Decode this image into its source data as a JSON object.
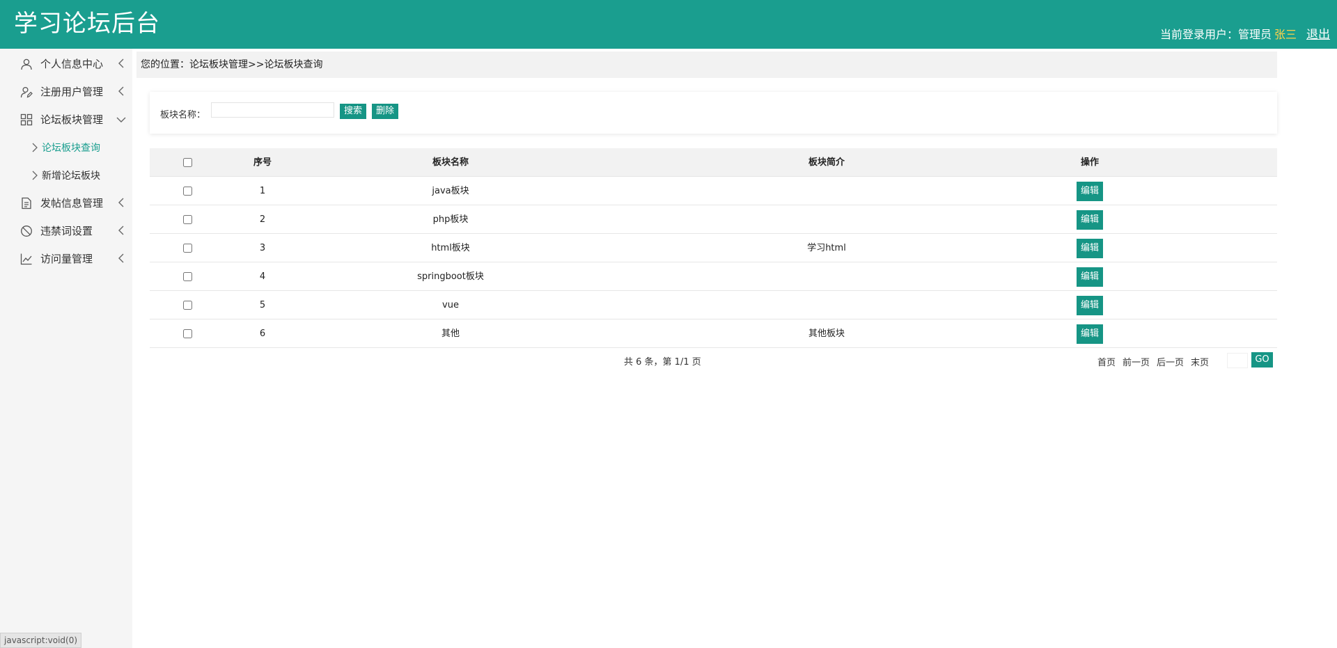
{
  "header": {
    "title": "学习论坛后台",
    "user_prefix": "当前登录用户：管理员",
    "user_name": "张三",
    "logout_label": "退出",
    "colors": {
      "primary": "#1a9e8f",
      "user_name": "#ffd24a"
    }
  },
  "sidebar": {
    "items": [
      {
        "label": "个人信息中心",
        "icon": "user-icon",
        "expanded": false
      },
      {
        "label": "注册用户管理",
        "icon": "user-edit-icon",
        "expanded": false
      },
      {
        "label": "论坛板块管理",
        "icon": "grid-icon",
        "expanded": true
      },
      {
        "label": "发帖信息管理",
        "icon": "document-icon",
        "expanded": false
      },
      {
        "label": "违禁词设置",
        "icon": "ban-icon",
        "expanded": false
      },
      {
        "label": "访问量管理",
        "icon": "line-chart-icon",
        "expanded": false
      }
    ],
    "subitems": [
      {
        "label": "论坛板块查询",
        "active": true
      },
      {
        "label": "新增论坛板块",
        "active": false
      }
    ]
  },
  "breadcrumb": {
    "prefix": "您的位置：",
    "section": "论坛板块管理",
    "separator": ">>",
    "page": "论坛板块查询"
  },
  "search": {
    "label": "板块名称：",
    "value": "",
    "search_button": "搜索",
    "delete_button": "删除"
  },
  "table": {
    "headers": {
      "no": "序号",
      "name": "板块名称",
      "desc": "板块简介",
      "op": "操作"
    },
    "rows": [
      {
        "no": "1",
        "name": "java板块",
        "desc": "",
        "op": "编辑"
      },
      {
        "no": "2",
        "name": "php板块",
        "desc": "",
        "op": "编辑"
      },
      {
        "no": "3",
        "name": "html板块",
        "desc": "学习html",
        "op": "编辑"
      },
      {
        "no": "4",
        "name": "springboot板块",
        "desc": "",
        "op": "编辑"
      },
      {
        "no": "5",
        "name": "vue",
        "desc": "",
        "op": "编辑"
      },
      {
        "no": "6",
        "name": "其他",
        "desc": "其他板块",
        "op": "编辑"
      }
    ]
  },
  "pagination": {
    "info": "共 6 条，第 1/1 页",
    "first": "首页",
    "prev": "前一页",
    "next": "后一页",
    "last": "末页",
    "go": "GO"
  },
  "statusbar": {
    "text": "javascript:void(0)"
  }
}
